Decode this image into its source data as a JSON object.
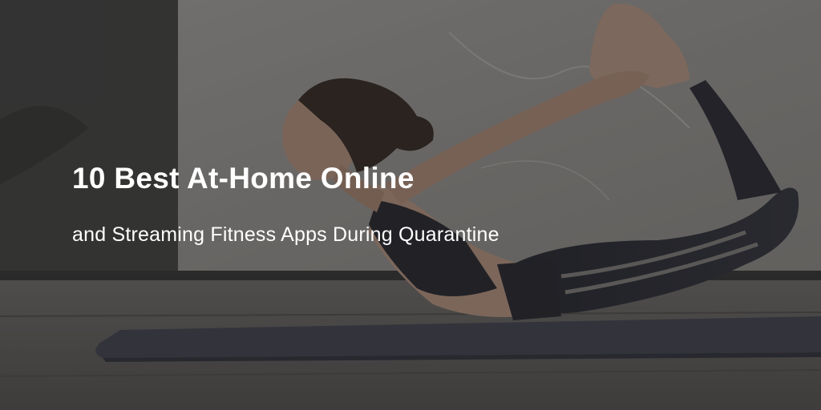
{
  "banner": {
    "headline": "10 Best At-Home Online",
    "subheadline": "and Streaming Fitness Apps During Quarantine"
  },
  "image": {
    "subject": "yoga-bow-pose-photo",
    "colors": {
      "text": "#ffffff",
      "overlay": "#141416",
      "wall": "#a9a6a1",
      "floor": "#6b6966",
      "mat": "#4b4d57"
    }
  }
}
